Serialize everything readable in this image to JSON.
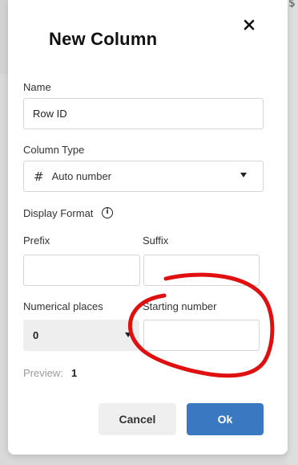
{
  "dialog": {
    "title": "New Column",
    "close_icon": "close-icon"
  },
  "fields": {
    "name": {
      "label": "Name",
      "value": "Row ID"
    },
    "column_type": {
      "label": "Column Type",
      "value": "Auto number",
      "icon": "hash-icon"
    },
    "display_format": {
      "label": "Display Format",
      "info_icon": "info-icon"
    },
    "prefix": {
      "label": "Prefix",
      "value": ""
    },
    "suffix": {
      "label": "Suffix",
      "value": ""
    },
    "numerical_places": {
      "label": "Numerical places",
      "value": "0"
    },
    "starting_number": {
      "label": "Starting number",
      "value": ""
    }
  },
  "preview": {
    "label": "Preview:",
    "value": "1"
  },
  "buttons": {
    "cancel": "Cancel",
    "ok": "Ok"
  },
  "colors": {
    "primary": "#3a78c2",
    "annotation": "#e01010"
  }
}
